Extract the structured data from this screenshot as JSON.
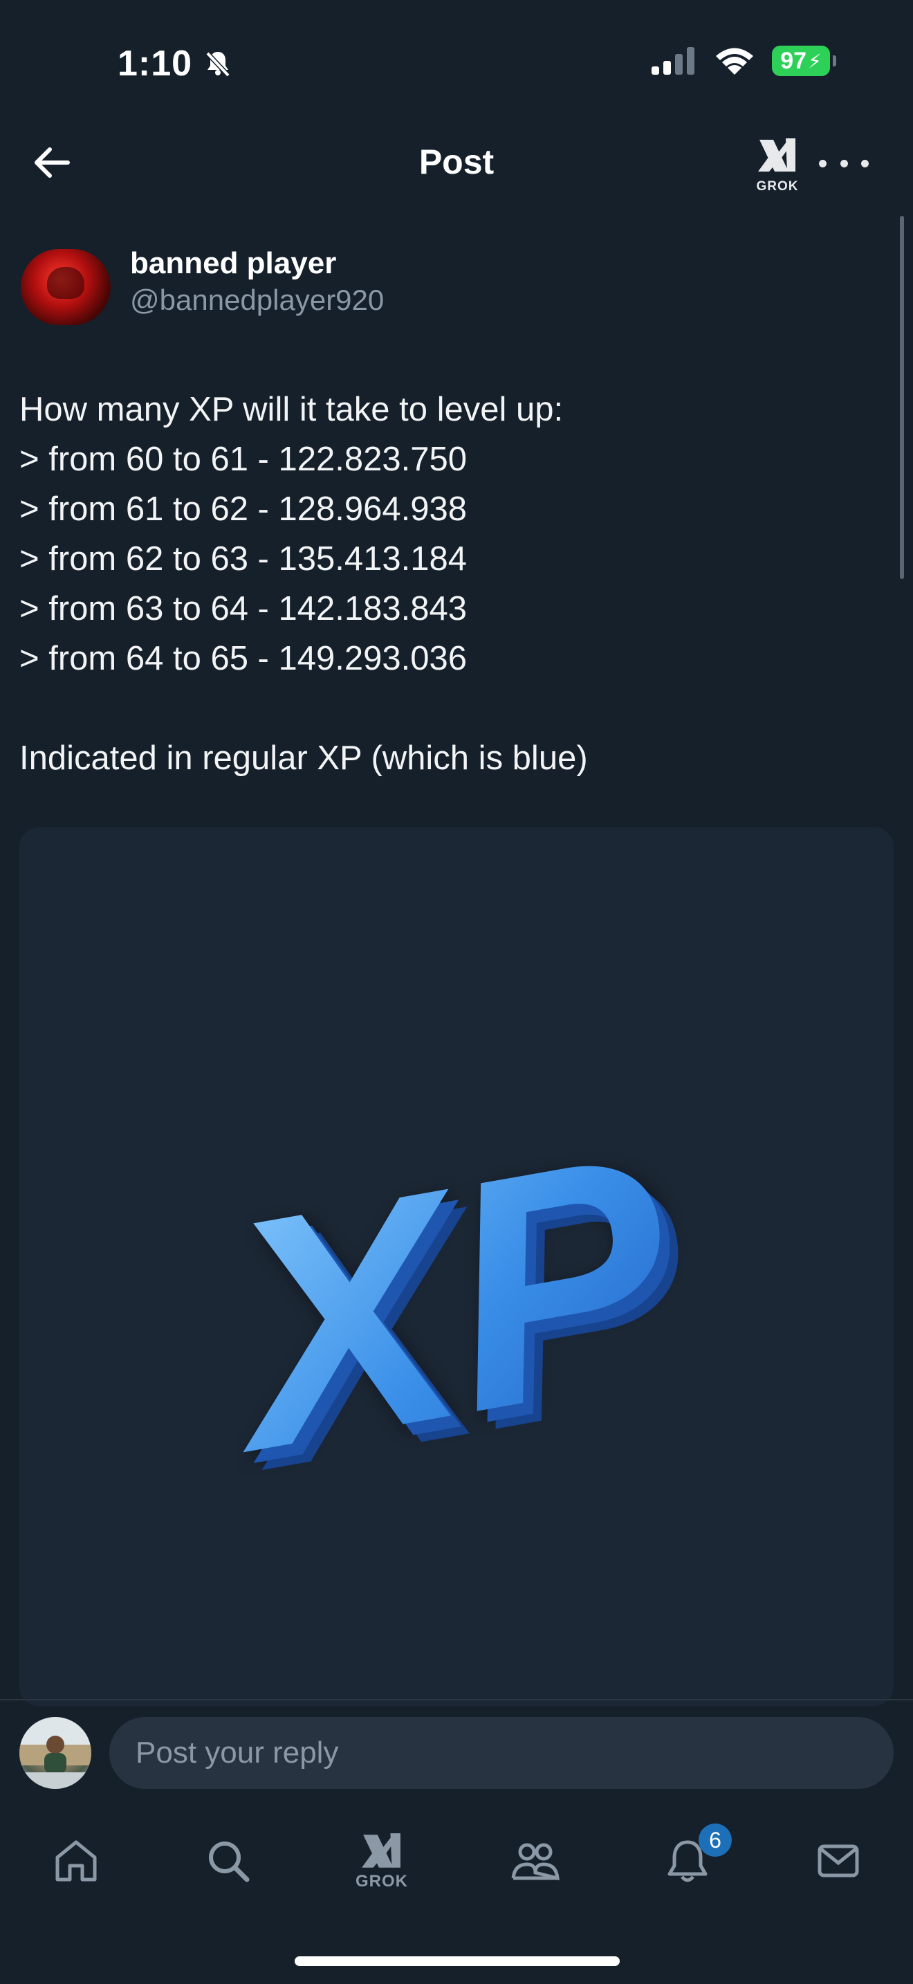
{
  "status_bar": {
    "time": "1:10",
    "battery": "97"
  },
  "header": {
    "title": "Post",
    "grok_label": "GROK"
  },
  "post": {
    "author_name": "banned player",
    "author_handle": "@bannedplayer920",
    "lines": [
      "How many XP will it take to level up:",
      "> from 60 to 61 - 122.823.750",
      "> from 61 to 62 - 128.964.938",
      "> from 62 to 63 - 135.413.184",
      "> from 63 to 64 - 142.183.843",
      "> from 64 to 65 - 149.293.036"
    ],
    "footer_line": "Indicated in regular XP (which is blue)",
    "media_text": "XP",
    "media_color": "#3a8fe8"
  },
  "reply": {
    "placeholder": "Post your reply"
  },
  "bottom_nav": {
    "items": [
      "home-icon",
      "search-icon",
      "grok-icon",
      "communities-icon",
      "notifications-icon",
      "messages-icon"
    ],
    "grok_label": "GROK",
    "notifications_badge": "6"
  },
  "colors": {
    "background": "#15202b",
    "accent": "#1d9bf0",
    "muted_text": "#8b98a5"
  }
}
